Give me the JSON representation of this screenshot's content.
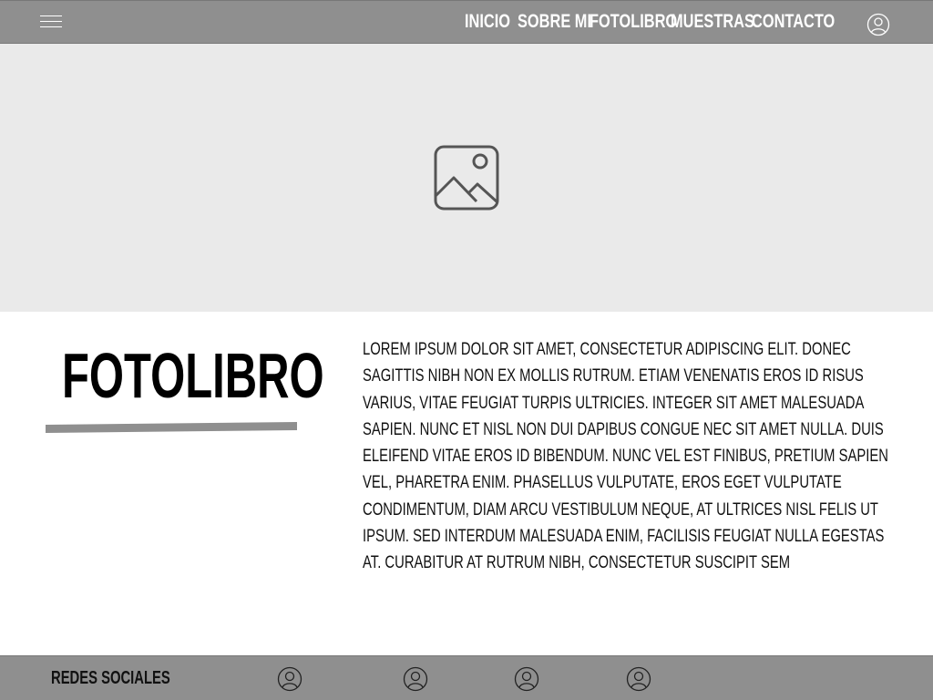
{
  "header": {
    "menu_icon": "hamburger-menu-icon",
    "nav": [
      {
        "label": "INICIO"
      },
      {
        "label": "SOBRE MI"
      },
      {
        "label": "FOTOLIBRO"
      },
      {
        "label": "MUESTRAS"
      },
      {
        "label": "CONTACTO"
      }
    ],
    "user_icon": "user-account-icon"
  },
  "hero": {
    "image_icon": "image-placeholder-icon"
  },
  "main": {
    "title": "FOTOLIBRO",
    "body": "LOREM IPSUM DOLOR SIT AMET, CONSECTETUR ADIPISCING ELIT. DONEC SAGITTIS NIBH NON EX MOLLIS RUTRUM. ETIAM VENENATIS EROS ID RISUS VARIUS, VITAE FEUGIAT TURPIS ULTRICIES. INTEGER SIT AMET MALESUADA SAPIEN. NUNC ET NISL NON DUI DAPIBUS CONGUE NEC SIT AMET NULLA. DUIS ELEIFEND VITAE EROS ID BIBENDUM. NUNC VEL EST FINIBUS, PRETIUM SAPIEN VEL, PHARETRA ENIM. PHASELLUS VULPUTATE, EROS EGET VULPUTATE CONDIMENTUM, DIAM ARCU VESTIBULUM NEQUE, AT ULTRICES NISL FELIS UT IPSUM. SED INTERDUM MALESUADA ENIM, FACILISIS FEUGIAT NULLA EGESTAS AT. CURABITUR AT RUTRUM NIBH, CONSECTETUR SUSCIPIT SEM"
  },
  "footer": {
    "label": "REDES SOCIALES",
    "social_icons": [
      "user-circle-icon",
      "user-circle-icon",
      "user-circle-icon",
      "user-circle-icon"
    ]
  },
  "colors": {
    "bar": "#8f8f8f",
    "hero_bg": "#eaeaea",
    "underline": "#8f8f8f",
    "nav_text": "#ffffff"
  }
}
